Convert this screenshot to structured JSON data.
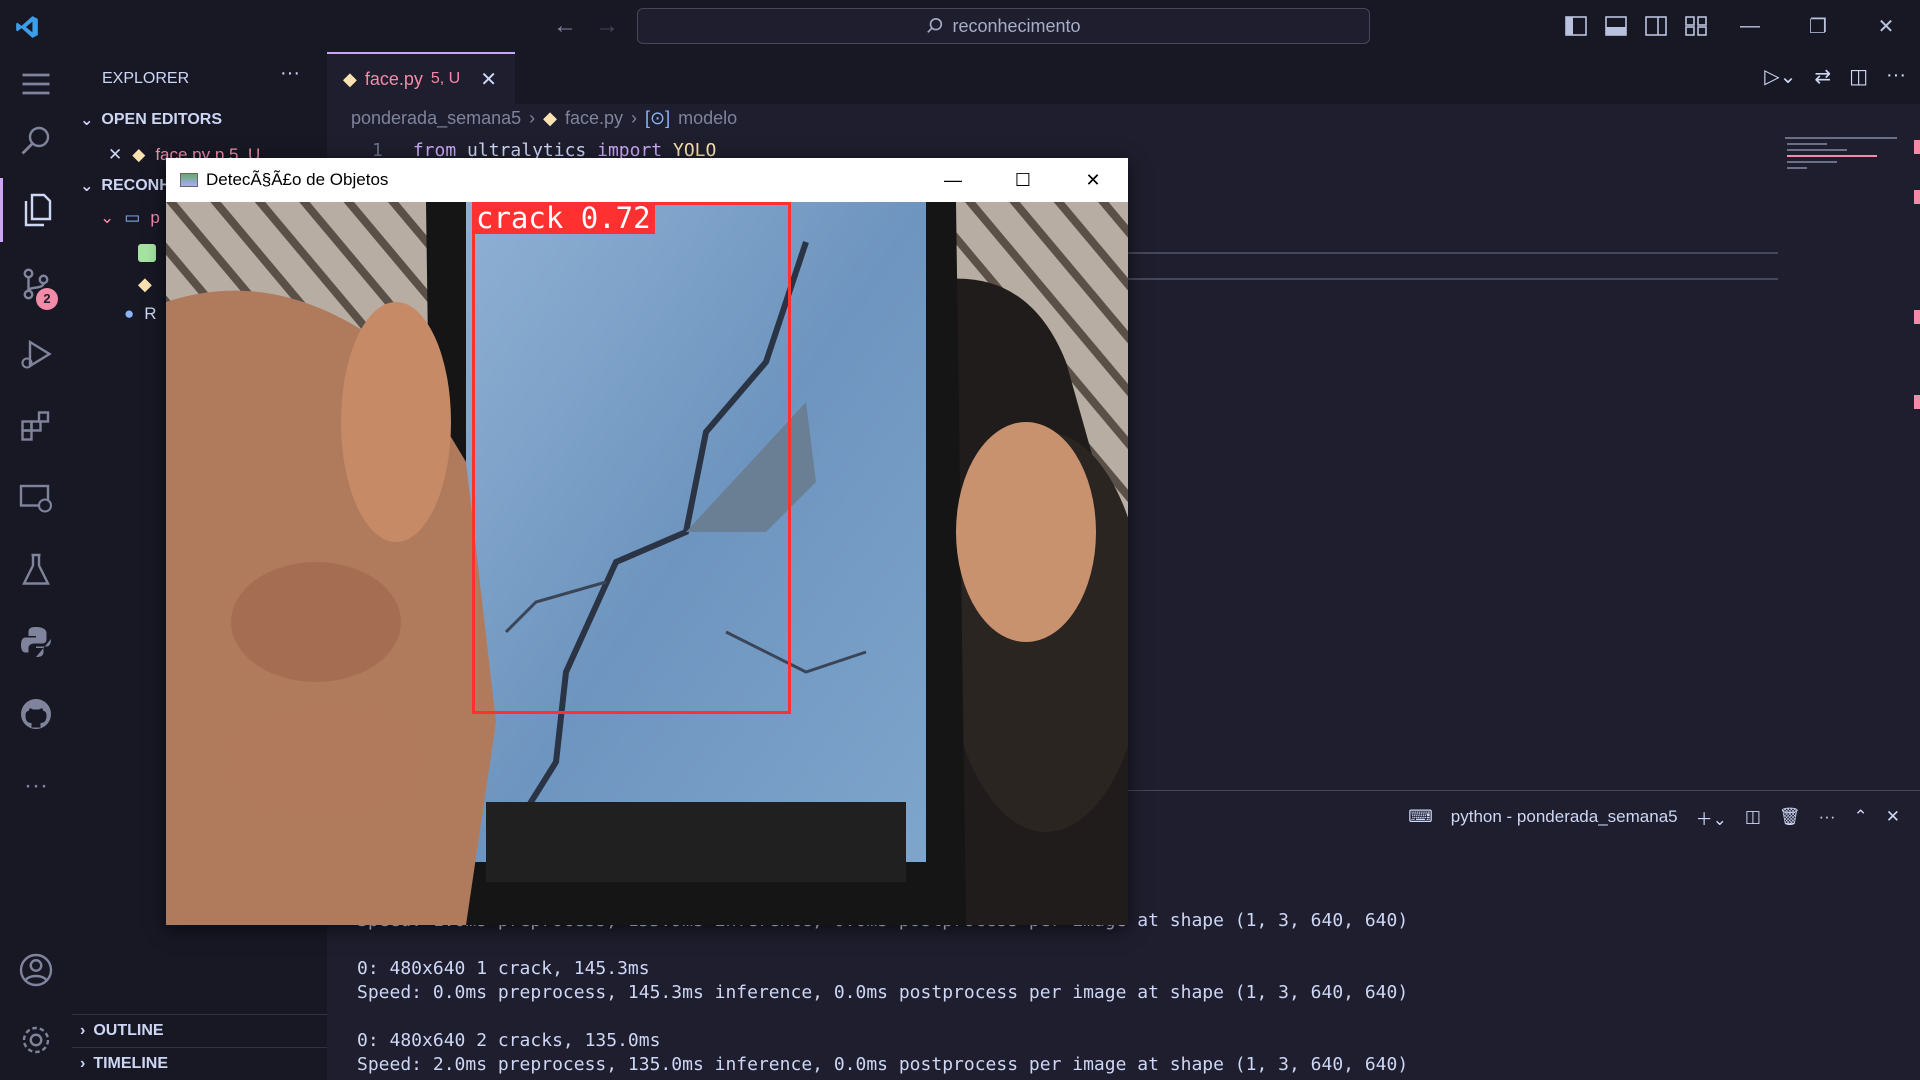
{
  "titlebar": {
    "search_text": "reconhecimento"
  },
  "activity": {
    "scm_badge": "2"
  },
  "sidebar": {
    "title": "EXPLORER",
    "open_editors": "OPEN EDITORS",
    "open_file": "face.py  p    5, U",
    "workspace": "RECONH",
    "folder_initial": "p",
    "readme_initial": "R",
    "outline": "OUTLINE",
    "timeline": "TIMELINE"
  },
  "editor": {
    "tab_name": "face.py",
    "tab_status": "5, U",
    "breadcrumb": [
      "ponderada_semana5",
      "face.py",
      "modelo"
    ],
    "line_number": "1",
    "code": {
      "from": "from",
      "module": "ultralytics",
      "import": "import",
      "name": "YOLO"
    }
  },
  "panel": {
    "terminal_title": "python - ponderada_semana5",
    "lines": [
      "Speed: 1.0ms preprocess, 155.9ms inference, 0.0ms postprocess per image at shape (1, 3, 640, 640)",
      "",
      "0: 480x640 1 crack, 145.3ms",
      "Speed: 0.0ms preprocess, 145.3ms inference, 0.0ms postprocess per image at shape (1, 3, 640, 640)",
      "",
      "0: 480x640 2 cracks, 135.0ms",
      "Speed: 2.0ms preprocess, 135.0ms inference, 0.0ms postprocess per image at shape (1, 3, 640, 640)"
    ]
  },
  "cv_window": {
    "title": "DetecÃ§Ã£o de Objetos",
    "detection_label": "crack 0.72"
  },
  "colors": {
    "accent": "#cba6f7",
    "error": "#f38ba8",
    "detection": "#ff3030"
  }
}
